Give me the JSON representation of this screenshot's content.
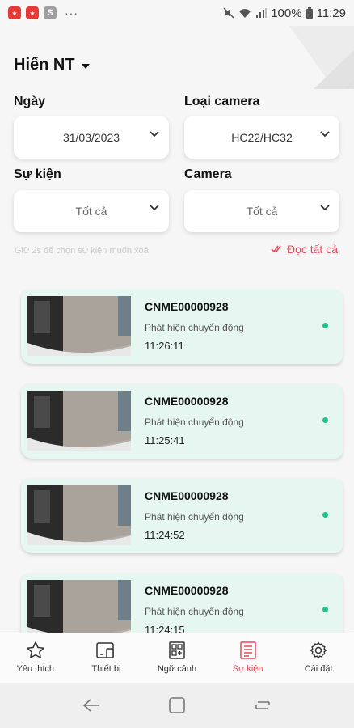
{
  "status_bar": {
    "app_icon_1": "Gift",
    "app_icon_2": "Gift",
    "app_icon_3": "S",
    "more": "···",
    "battery": "100%",
    "time": "11:29"
  },
  "header": {
    "user_name": "Hiến NT"
  },
  "filters": {
    "date_label": "Ngày",
    "date_value": "31/03/2023",
    "camera_type_label": "Loại camera",
    "camera_type_value": "HC22/HC32",
    "event_label": "Sự kiện",
    "event_value": "Tốt cả",
    "camera_label": "Camera",
    "camera_value": "Tốt cả"
  },
  "hint": "Giữ 2s để chọn sự kiện muốn xoá",
  "read_all": "Đọc tất cả",
  "events": [
    {
      "camera": "CNME00000928",
      "type": "Phát hiện chuyển động",
      "time": "11:26:11"
    },
    {
      "camera": "CNME00000928",
      "type": "Phát hiện chuyển động",
      "time": "11:25:41"
    },
    {
      "camera": "CNME00000928",
      "type": "Phát hiện chuyển động",
      "time": "11:24:52"
    },
    {
      "camera": "CNME00000928",
      "type": "Phát hiện chuyển động",
      "time": "11:24:15"
    }
  ],
  "nav": [
    {
      "label": "Yêu thích",
      "icon": "star-icon"
    },
    {
      "label": "Thiết bị",
      "icon": "devices-icon"
    },
    {
      "label": "Ngữ cảnh",
      "icon": "scene-icon"
    },
    {
      "label": "Sự kiện",
      "icon": "event-list-icon",
      "active": true
    },
    {
      "label": "Cài đặt",
      "icon": "gear-icon"
    }
  ],
  "colors": {
    "accent": "#e64a5b",
    "card_bg": "#e6f6f1",
    "unread_dot": "#1ec28b"
  }
}
